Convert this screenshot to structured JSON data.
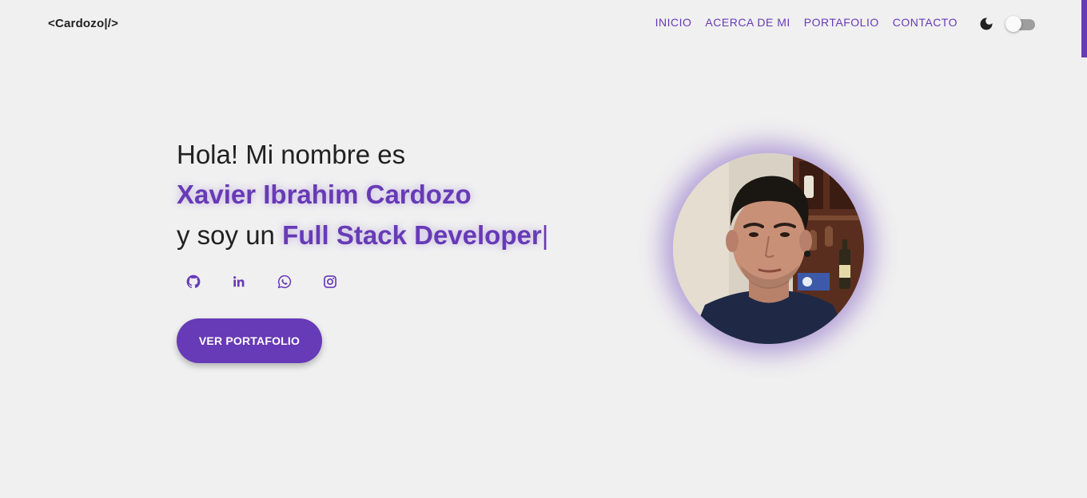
{
  "navbar": {
    "logo": "<Cardozo|/>",
    "links": [
      "INICIO",
      "ACERCA DE MI",
      "PORTAFOLIO",
      "CONTACTO"
    ],
    "theme_icon": "moon-icon",
    "dark_mode_on": false
  },
  "hero": {
    "greeting": "Hola! Mi nombre es",
    "name": "Xavier Ibrahim Cardozo",
    "role_prefix": "y soy un ",
    "role": "Full Stack Developer",
    "cursor": "|",
    "socials": [
      {
        "icon": "github-icon"
      },
      {
        "icon": "linkedin-icon"
      },
      {
        "icon": "whatsapp-icon"
      },
      {
        "icon": "instagram-icon"
      }
    ],
    "cta_label": "VER PORTAFOLIO"
  },
  "colors": {
    "accent": "#673ab7",
    "background": "#f0f0f0",
    "text": "#212121"
  }
}
